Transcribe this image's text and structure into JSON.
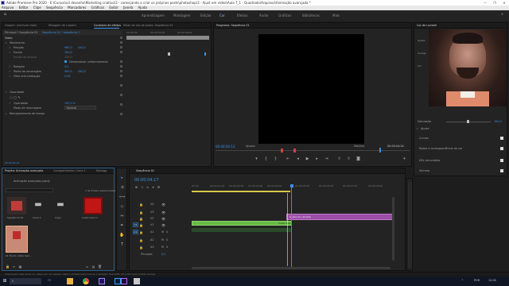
{
  "window": {
    "title": "Adobe Premiere Pro 2020 - E:\\Cursos\\o3 desenho\\Marketing criativo\\3 - começando a criar os próprios posts\\photoshop\\3 - Ajust em vídeo\\Aula 7_1 - Quadrado\\Arquivos\\Animação avançada *",
    "controls": [
      "—",
      "❐",
      "✕"
    ]
  },
  "menu": [
    "Arquivo",
    "Editar",
    "Clipe",
    "Sequência",
    "Marcadores",
    "Gráficos",
    "Exibir",
    "Janela",
    "Ajuda"
  ],
  "workspaces": {
    "home_icon": "home-icon",
    "items": [
      "Aprendizagem",
      "Montagem",
      "Edição",
      "Cor",
      "Efeitos",
      "Áudio",
      "Gráficos",
      "Bibliotecas",
      "Mais"
    ],
    "active": "Edição",
    "search_icon": "search-icon"
  },
  "source_panel": {
    "tabs": [
      "Origem: (nenhum clipe)",
      "Mixagem de Lumetri",
      "Controles de efeitos",
      "Mixer de clip de áudio: Sequência 01"
    ],
    "active_tab": "Controles de efeitos",
    "master": "Principal * Sequência 01",
    "master_right": "Sequência 01 * sequência 1",
    "ruler": [
      "00:00:00",
      "00:00:04:00",
      "00:00:08:00"
    ],
    "video_header": "Vídeo",
    "movement": "Movimento",
    "rows": [
      {
        "label": "Posição",
        "v1": "960,0",
        "v2": "540,0"
      },
      {
        "label": "Escala",
        "v1": "100,0",
        "v2": ""
      },
      {
        "label": "Escala da largura",
        "v1": "100,0",
        "v2": ""
      },
      {
        "label": "",
        "v1": "",
        "v2": ""
      },
      {
        "label": "Rotação",
        "v1": "0,0",
        "v2": ""
      },
      {
        "label": "Ponto de ancoragem",
        "v1": "960,0",
        "v2": "540,0"
      },
      {
        "label": "Filtro anti-cintilação",
        "v1": "0,00",
        "v2": ""
      }
    ],
    "uniform_scale": "Dimensionar uniformemente",
    "opacity_header": "Opacidade",
    "opacity_label": "Opacidade",
    "opacity_value": "100,0 %",
    "blend_label": "Modo de mesclagem",
    "blend_value": "Normal",
    "time_remap": "Remapeamento de tempo",
    "timecode": "00:00:04:13"
  },
  "program_monitor": {
    "title": "Programa: Sequência 01",
    "timecode_left": "00:00:04:13",
    "fit": "Ajustar",
    "quality": "Máxima",
    "timecode_right": "00:00:04:24"
  },
  "lumetri_panel": {
    "title": "Cor de Lumetri",
    "fields": [
      "Ajuste",
      "Corrigir",
      "Cor ",
      "Correspondência de cor",
      "HSL secundária",
      "Vinheta"
    ],
    "saturation_label": "Saturação",
    "saturation_value": "100,0",
    "checks": [
      "Curvas",
      "Rodas e correspondência de cor",
      "HSL secundária",
      "Vinheta"
    ]
  },
  "project_panel": {
    "tabs": [
      "Projeto: Animação avançada",
      "Compartimento: Cena 1",
      "Navegg"
    ],
    "file": "Animação avançada.prproj",
    "count": "1 de 5 itens selecionados",
    "items": [
      {
        "name": "Sequência 01",
        "dur": "4:24",
        "kind": "seq-red"
      },
      {
        "name": "Cena 1",
        "dur": "",
        "kind": "folder"
      },
      {
        "name": "Capa",
        "dur": "",
        "kind": "folder"
      },
      {
        "name": "aula1-Cena 1",
        "dur": "",
        "kind": "red"
      },
      {
        "name": "01 Fundo vídeo Sad...",
        "dur": "5:01",
        "kind": "selected"
      }
    ]
  },
  "timeline": {
    "tab": "Sequência 01",
    "timecode": "00:00:04:17",
    "ruler": [
      "00:00",
      "00:00:01:00",
      "00:00:02:00",
      "00:00:03:00",
      "00:00:04:00",
      "00:00:05:00",
      "00:00:06:00",
      "00:00:07:00",
      "00:00:08:00"
    ],
    "video_tracks": [
      "V4",
      "V3",
      "V2",
      "V1"
    ],
    "audio_tracks": [
      "A1",
      "A2",
      "A3"
    ],
    "master": "Principal",
    "master_value": "0,0",
    "clip_video": "Ajuste de camada",
    "clip_green": "Vídeo Sad.mp4 [V]"
  },
  "status_bar": "Clique para selecionar ou clique em um espaço vazio e arraste para marcar a seleção. Use Shift, Alt e Ctrl para outras opções.",
  "taskbar": {
    "icons": [
      "windows-icon",
      "search-icon",
      "task-view-icon",
      "folder-icon",
      "chrome-icon",
      "premiere-icon",
      "photoshop-icon",
      "after-effects-icon",
      "app-icon"
    ],
    "right": [
      "^",
      "POR",
      "12:00"
    ]
  }
}
